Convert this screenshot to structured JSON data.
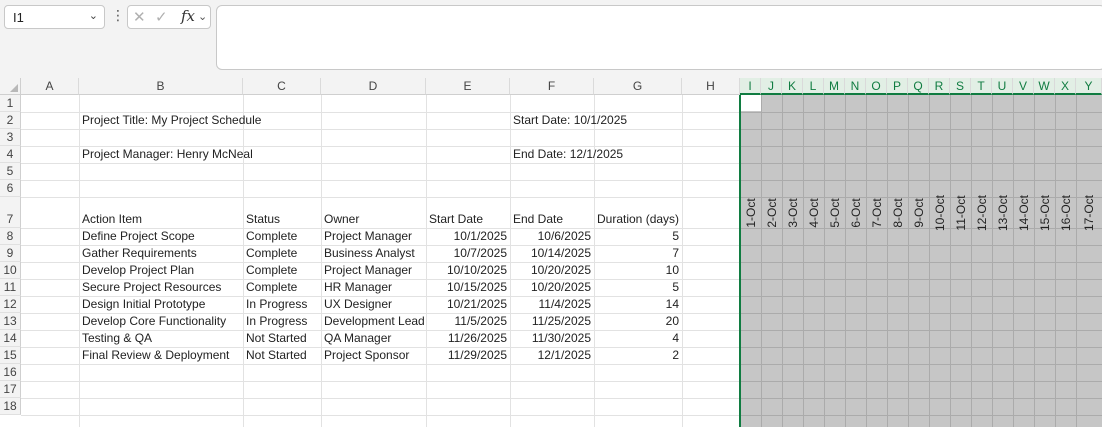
{
  "formula_bar": {
    "name_box": "I1",
    "formula": ""
  },
  "columns": [
    "A",
    "B",
    "C",
    "D",
    "E",
    "F",
    "G",
    "H",
    "I",
    "J",
    "K",
    "L",
    "M",
    "N",
    "O",
    "P",
    "Q",
    "R",
    "S",
    "T",
    "U",
    "V",
    "W",
    "X",
    "Y"
  ],
  "rows": [
    "1",
    "2",
    "3",
    "4",
    "5",
    "6",
    "7",
    "8",
    "9",
    "10",
    "11",
    "12",
    "13",
    "14",
    "15",
    "16",
    "17",
    "18"
  ],
  "project": {
    "title": "Project Title: My Project Schedule",
    "start": "Start Date: 10/1/2025",
    "manager": "Project Manager: Henry McNeal",
    "end": "End Date: 12/1/2025"
  },
  "table_headers": [
    "Action Item",
    "Status",
    "Owner",
    "Start Date",
    "End Date",
    "Duration (days)"
  ],
  "tasks": [
    [
      "Define Project Scope",
      "Complete",
      "Project Manager",
      "10/1/2025",
      "10/6/2025",
      "5"
    ],
    [
      "Gather Requirements",
      "Complete",
      "Business Analyst",
      "10/7/2025",
      "10/14/2025",
      "7"
    ],
    [
      "Develop Project Plan",
      "Complete",
      "Project Manager",
      "10/10/2025",
      "10/20/2025",
      "10"
    ],
    [
      "Secure Project Resources",
      "Complete",
      "HR Manager",
      "10/15/2025",
      "10/20/2025",
      "5"
    ],
    [
      "Design Initial Prototype",
      "In Progress",
      "UX Designer",
      "10/21/2025",
      "11/4/2025",
      "14"
    ],
    [
      "Develop Core Functionality",
      "In Progress",
      "Development Lead",
      "11/5/2025",
      "11/25/2025",
      "20"
    ],
    [
      "Testing & QA",
      "Not Started",
      "QA Manager",
      "11/26/2025",
      "11/30/2025",
      "4"
    ],
    [
      "Final Review & Deployment",
      "Not Started",
      "Project Sponsor",
      "11/29/2025",
      "12/1/2025",
      "2"
    ]
  ],
  "gantt_dates": [
    "1-Oct",
    "2-Oct",
    "3-Oct",
    "4-Oct",
    "5-Oct",
    "6-Oct",
    "7-Oct",
    "8-Oct",
    "9-Oct",
    "10-Oct",
    "11-Oct",
    "12-Oct",
    "13-Oct",
    "14-Oct",
    "15-Oct",
    "16-Oct",
    "17-Oct"
  ],
  "colors": {
    "selection": "#107c41",
    "gantt_fill": "#c6c6c6"
  }
}
